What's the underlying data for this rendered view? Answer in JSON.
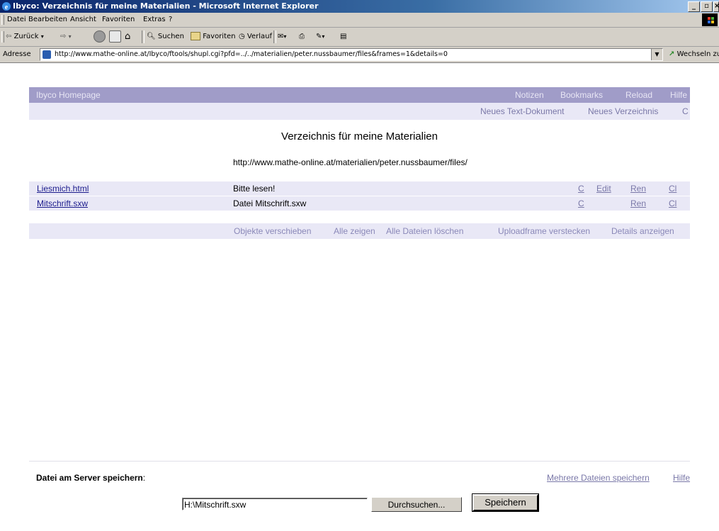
{
  "window": {
    "title": "Ibyco: Verzeichnis für meine Materialien - Microsoft Internet Explorer",
    "controls": [
      "_",
      "\u0000",
      "x"
    ]
  },
  "menu": [
    "Datei",
    "Bearbeiten",
    "Ansicht",
    "Favoriten",
    "Extras",
    "?"
  ],
  "toolbar": {
    "back": "Zurück",
    "search": "Suchen",
    "favorites": "Favoriten",
    "history": "Verlauf"
  },
  "address": {
    "label": "Adresse",
    "url": "http://www.mathe-online.at/Ibyco/ftools/shupl.cgi?pfd=../../materialien/peter.nussbaumer/files&frames=1&details=0",
    "go_label": "Wechseln zu"
  },
  "page": {
    "topbar": {
      "home": "Ibyco Homepage",
      "links": [
        "Notizen",
        "Bookmarks",
        "Reload",
        "Hilfe"
      ]
    },
    "subbar": [
      "Neues Text-Dokument",
      "Neues Verzeichnis",
      "C"
    ],
    "heading": "Verzeichnis für meine Materialien",
    "path": "http://www.mathe-online.at/materialien/peter.nussbaumer/files/",
    "files": [
      {
        "name": "Liesmich.html",
        "description": "Bitte lesen!",
        "c": "C",
        "edit": "Edit",
        "ren": "Ren",
        "cl": "Cl"
      },
      {
        "name": "Mitschrift.sxw",
        "description": "Datei Mitschrift.sxw",
        "c": "C",
        "edit": "",
        "ren": "Ren",
        "cl": "Cl"
      }
    ],
    "actions": [
      "Objekte verschieben",
      "Alle zeigen",
      "Alle Dateien löschen",
      "Uploadframe verstecken",
      "Details anzeigen"
    ],
    "upload": {
      "label": "Datei am Server speichern",
      "colon": ":",
      "multi_link": "Mehrere Dateien speichern",
      "help_link": "Hilfe",
      "file_value": "H:\\Mitschrift.sxw",
      "browse_label": "Durchsuchen...",
      "submit_label": "Speichern"
    }
  }
}
